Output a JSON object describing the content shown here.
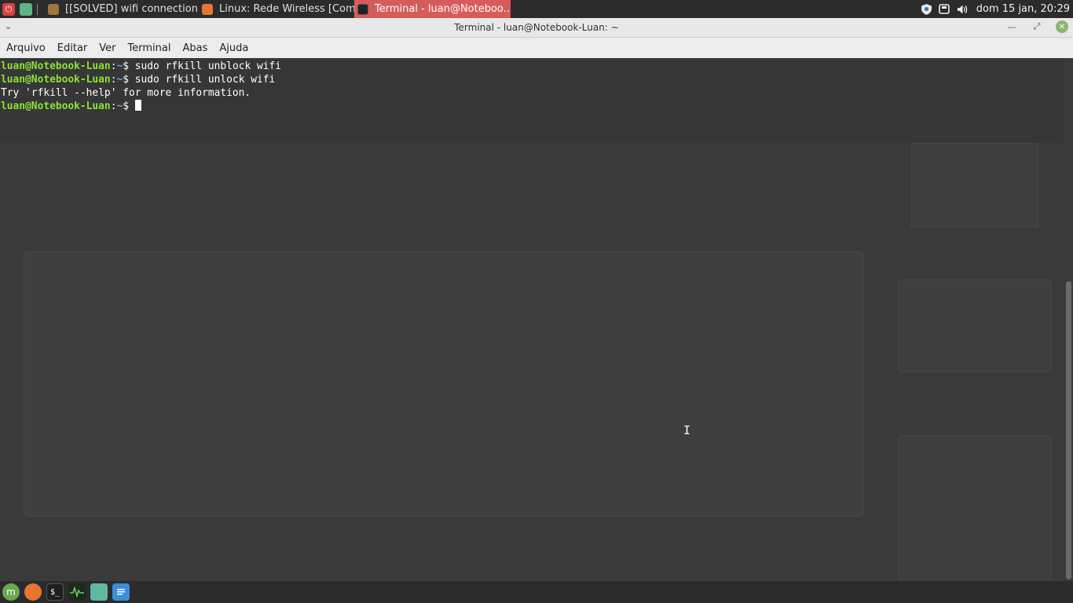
{
  "top_panel": {
    "tasks": [
      {
        "label": "[[SOLVED] wifi connection ...",
        "icon": "firefox-icon",
        "active": false
      },
      {
        "label": "Linux: Rede Wireless [Com...",
        "icon": "firefox-icon",
        "active": false
      },
      {
        "label": "Terminal - luan@Noteboo...",
        "icon": "terminal-icon",
        "active": true
      }
    ],
    "clock": "dom 15 jan, 20:29",
    "tray_icons": [
      "shield-icon",
      "network-icon",
      "volume-icon"
    ]
  },
  "window": {
    "title": "Terminal - luan@Notebook-Luan: ~"
  },
  "menubar": {
    "items": [
      "Arquivo",
      "Editar",
      "Ver",
      "Terminal",
      "Abas",
      "Ajuda"
    ]
  },
  "terminal": {
    "user_host": "luan@Notebook-Luan",
    "path": "~",
    "prompt_suffix": "$ ",
    "lines": [
      {
        "type": "cmd",
        "command": "sudo rfkill unblock wifi"
      },
      {
        "type": "cmd",
        "command": "sudo rfkill unlock wifi"
      },
      {
        "type": "out",
        "text": "Try 'rfkill --help' for more information."
      },
      {
        "type": "cmd",
        "command": ""
      }
    ]
  },
  "colors": {
    "active_task": "#d65c5c",
    "prompt_user": "#8ae234",
    "prompt_path": "#729fcf",
    "close_button": "#8fb56f"
  },
  "dock": {
    "apps": [
      "mint-menu-icon",
      "firefox-icon",
      "terminal-icon",
      "system-monitor-icon",
      "files-icon",
      "text-editor-icon"
    ]
  }
}
